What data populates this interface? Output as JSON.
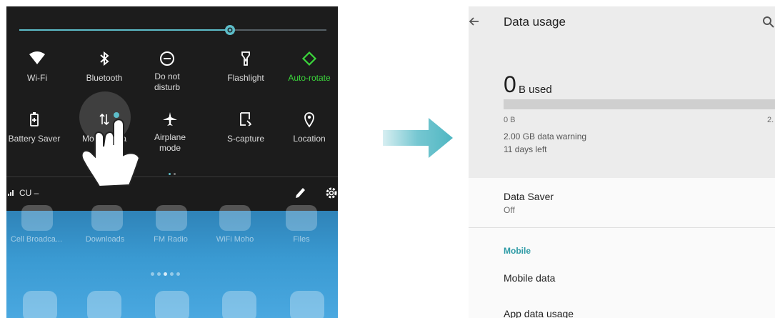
{
  "quick_settings": {
    "brightness_level": 0.68,
    "tiles_row1": [
      {
        "label": "Wi-Fi",
        "sub": "",
        "icon": "wifi-icon",
        "active": false
      },
      {
        "label": "Bluetooth",
        "sub": "",
        "icon": "bluetooth-icon",
        "active": false
      },
      {
        "label": "Do not",
        "sub": "disturb",
        "icon": "do-not-disturb-icon",
        "active": false
      },
      {
        "label": "Flashlight",
        "sub": "",
        "icon": "flashlight-icon",
        "active": false
      },
      {
        "label": "Auto-rotate",
        "sub": "",
        "icon": "auto-rotate-icon",
        "active": true
      }
    ],
    "tiles_row2": [
      {
        "label": "Battery Saver",
        "sub": "",
        "icon": "battery-saver-icon"
      },
      {
        "label": "Mobile data",
        "sub": "Off",
        "icon": "mobile-data-icon"
      },
      {
        "label": "Airplane",
        "sub": "mode",
        "icon": "airplane-icon"
      },
      {
        "label": "S-capture",
        "sub": "",
        "icon": "screenshot-icon"
      },
      {
        "label": "Location",
        "sub": "",
        "icon": "location-icon"
      }
    ],
    "carrier": "CU –"
  },
  "home_apps": [
    "Cell Broadca...",
    "Downloads",
    "FM Radio",
    "WiFi Moho",
    "Files"
  ],
  "data_usage": {
    "title": "Data usage",
    "used_value": "0",
    "used_unit": "B used",
    "usage_fraction": 0.0,
    "scale_min": "0 B",
    "scale_max": "2.",
    "warning": "2.00 GB data warning",
    "days_left": "11 days left",
    "data_saver_title": "Data Saver",
    "data_saver_state": "Off",
    "section_mobile": "Mobile",
    "mobile_data": "Mobile data",
    "app_data_usage": "App data usage"
  },
  "colors": {
    "accent": "#5dbdc9",
    "active": "#3bd43b",
    "section": "#2e9ba6"
  }
}
